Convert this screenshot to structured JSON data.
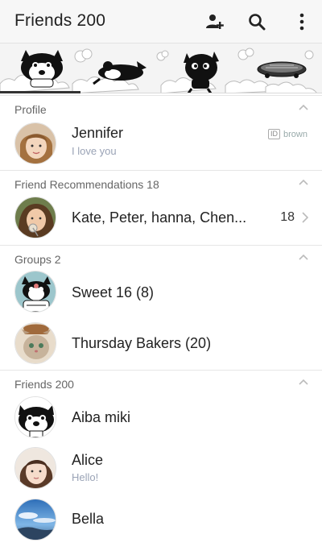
{
  "appbar": {
    "title": "Friends 200",
    "icons": [
      "add-friend-icon",
      "search-icon",
      "more-vert-icon"
    ]
  },
  "banner": {
    "characters": [
      "boston-terrier-character",
      "lying-character",
      "black-devil-character",
      "hoverboard-character"
    ]
  },
  "profile": {
    "header": "Profile",
    "name": "Jennifer",
    "status": "I love you",
    "id_label": "ID",
    "id_value": "brown"
  },
  "recommendations": {
    "header": "Friend Recommendations 18",
    "names": "Kate, Peter, hanna, Chen...",
    "count": "18"
  },
  "groups": {
    "header": "Groups 2",
    "items": [
      {
        "name": "Sweet 16 (8)"
      },
      {
        "name": "Thursday Bakers (20)"
      }
    ]
  },
  "friends": {
    "header": "Friends 200",
    "items": [
      {
        "name": "Aiba miki",
        "status": ""
      },
      {
        "name": "Alice",
        "status": "Hello!"
      },
      {
        "name": "Bella",
        "status": ""
      }
    ]
  },
  "colors": {
    "status_text": "#9aa3b6",
    "appbar_bg": "#f7f7f7",
    "divider": "#e6e6e6"
  }
}
